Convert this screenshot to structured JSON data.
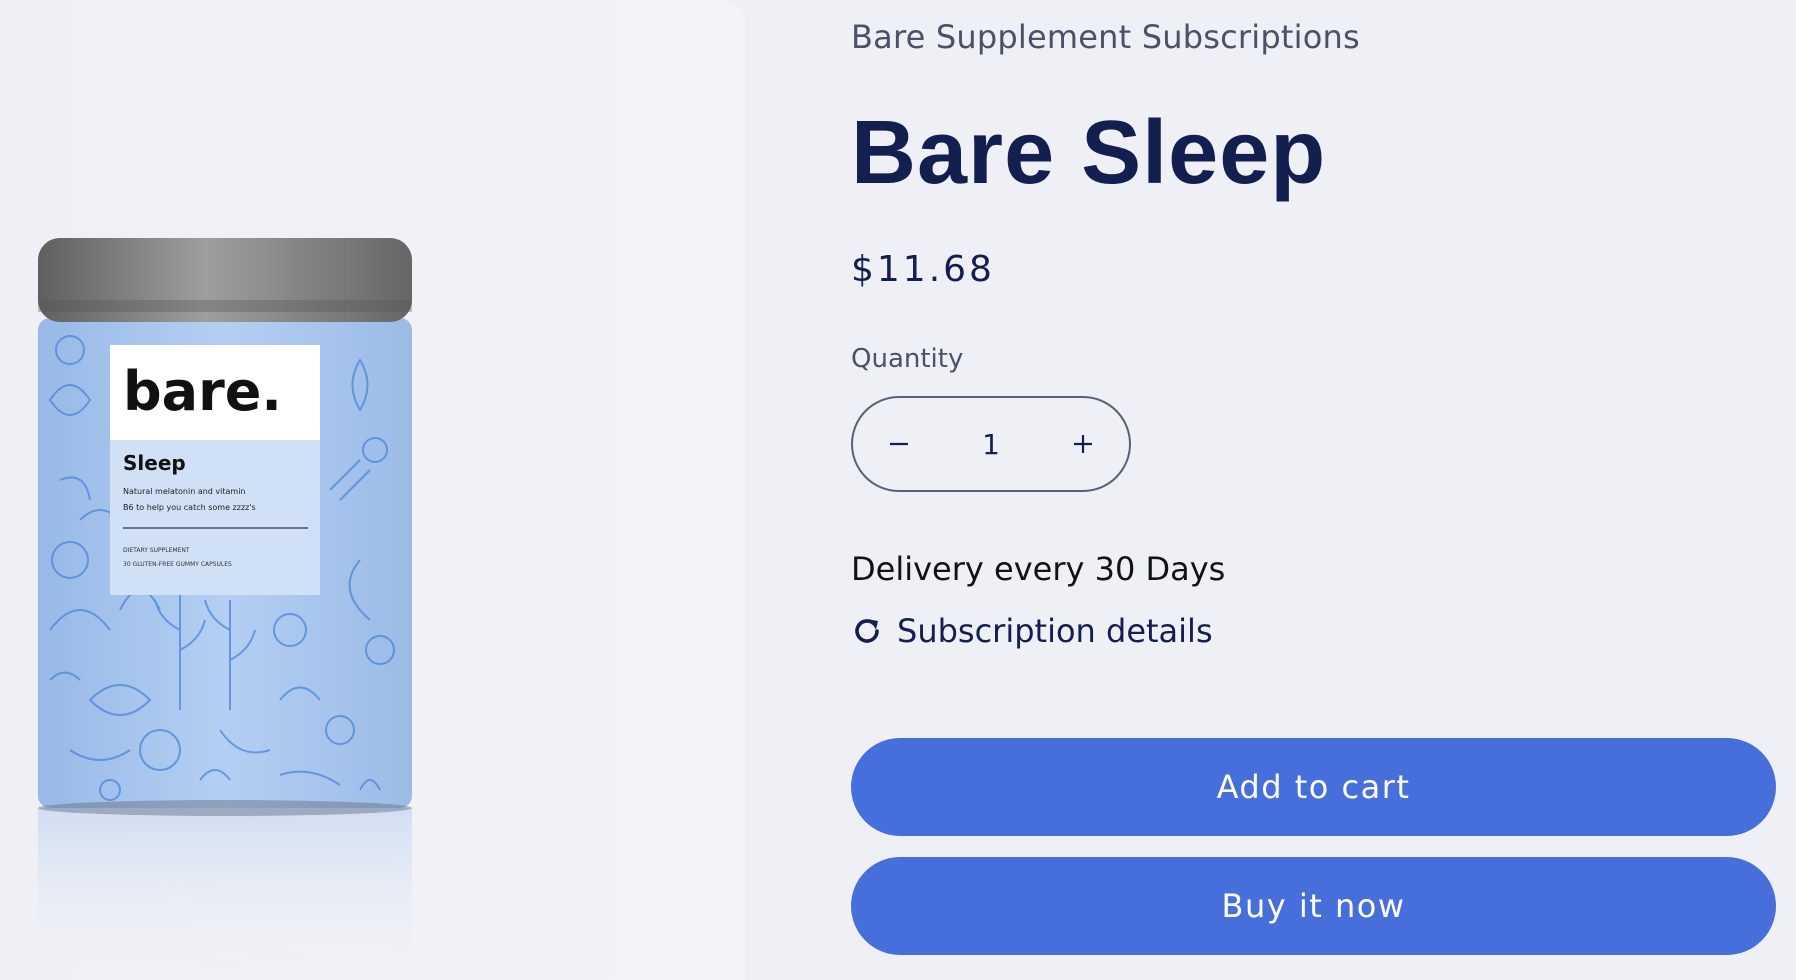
{
  "product": {
    "vendor": "Bare Supplement Subscriptions",
    "title": "Bare Sleep",
    "price": "$11.68",
    "quantity_label": "Quantity",
    "quantity": "1",
    "delivery_text": "Delivery every 30 Days",
    "subscription_details_label": "Subscription details",
    "add_to_cart_label": "Add to cart",
    "buy_now_label": "Buy it now"
  },
  "image": {
    "brand": "bare.",
    "product_name": "Sleep",
    "tagline_line1": "Natural melatonin and vitamin",
    "tagline_line2": "B6 to help you catch some zzzz's",
    "fine_print_line1": "DIETARY SUPPLEMENT",
    "fine_print_line2": "30 GLUTEN-FREE GUMMY CAPSULES"
  },
  "icons": {
    "minus": "minus-icon",
    "plus": "plus-icon",
    "subscription": "refresh-icon"
  },
  "colors": {
    "background": "#eff0f5",
    "title": "#121f4f",
    "button": "#476fdc",
    "button_text": "#ffffff",
    "can_label": "#a9c6f0",
    "can_lid": "#8a8a8a"
  }
}
